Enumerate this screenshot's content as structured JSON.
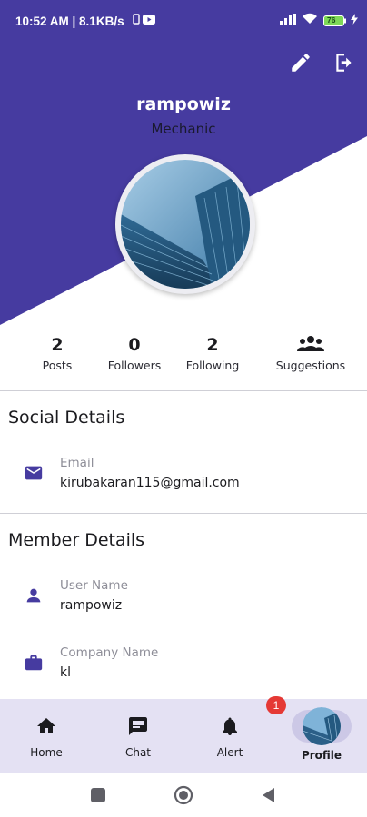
{
  "status_bar": {
    "time": "10:52 AM | 8.1KB/s",
    "battery": "76"
  },
  "colors": {
    "primary": "#463ba0",
    "nav_bg": "#e4e1f3",
    "badge": "#e53935"
  },
  "header": {
    "edit_icon": "pencil-icon",
    "logout_icon": "logout-icon",
    "username": "rampowiz",
    "role": "Mechanic"
  },
  "stats": [
    {
      "value": "2",
      "label": "Posts"
    },
    {
      "value": "0",
      "label": "Followers"
    },
    {
      "value": "2",
      "label": "Following"
    },
    {
      "label": "Suggestions",
      "icon": "group-icon"
    }
  ],
  "social": {
    "title": "Social Details",
    "email_label": "Email",
    "email_value": "kirubakaran115@gmail.com"
  },
  "member": {
    "title": "Member Details",
    "username_label": "User Name",
    "username_value": "rampowiz",
    "company_label": "Company Name",
    "company_value": "kl"
  },
  "bottom_nav": {
    "items": [
      {
        "label": "Home",
        "icon": "home-icon"
      },
      {
        "label": "Chat",
        "icon": "chat-icon"
      },
      {
        "label": "Alert",
        "icon": "bell-icon"
      },
      {
        "label": "Profile",
        "icon": "avatar"
      }
    ],
    "alert_badge": "1"
  }
}
